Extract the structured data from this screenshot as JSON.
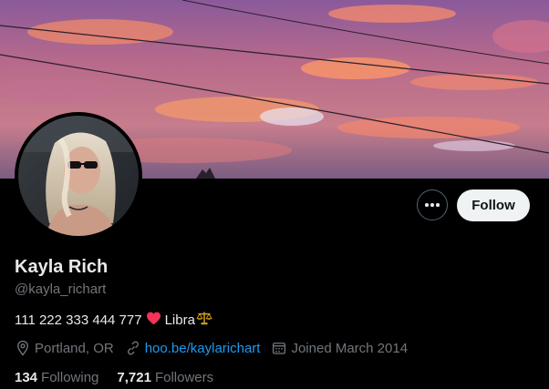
{
  "profile": {
    "display_name": "Kayla Rich",
    "handle": "@kayla_richart",
    "bio_text": "111 222 333 444 777",
    "bio_heart": "❤️",
    "bio_sign": "Libra",
    "bio_sign_emoji": "⚖️",
    "location": "Portland, OR",
    "website": "hoo.be/kaylarichart",
    "joined": "Joined March 2014",
    "following_count": "134",
    "following_label": "Following",
    "followers_count": "7,721",
    "followers_label": "Followers"
  },
  "actions": {
    "follow_label": "Follow",
    "more_icon": "more-horizontal-icon"
  },
  "icons": {
    "location": "location-pin-icon",
    "link": "link-icon",
    "calendar": "calendar-icon"
  },
  "colors": {
    "background": "#000000",
    "primary_text": "#e7e9ea",
    "secondary_text": "#71767b",
    "link": "#1d9bf0",
    "follow_button_bg": "#eff3f4",
    "follow_button_text": "#0f1419"
  }
}
